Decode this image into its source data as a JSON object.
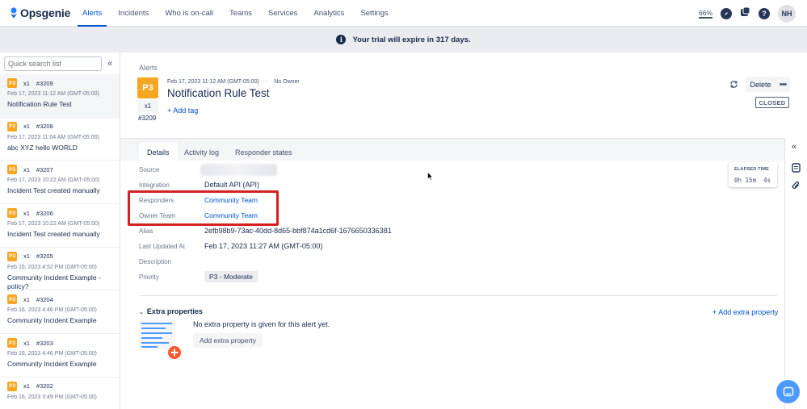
{
  "app": {
    "name": "Opsgenie"
  },
  "nav": {
    "links": [
      "Alerts",
      "Incidents",
      "Who is on-call",
      "Teams",
      "Services",
      "Analytics",
      "Settings"
    ],
    "zoom": "66%",
    "avatar_initials": "NH"
  },
  "banner": {
    "text": "Your trial will expire in 317 days."
  },
  "sidebar": {
    "search_placeholder": "Quick search list",
    "items": [
      {
        "priority": "P3",
        "count": "x1",
        "id": "#3209",
        "date": "Feb 17, 2023 11:12 AM (GMT-05:00)",
        "title": "Notification Rule Test"
      },
      {
        "priority": "P3",
        "count": "x1",
        "id": "#3208",
        "date": "Feb 17, 2023 11:04 AM (GMT-05:00)",
        "title": "abc XYZ hello WORLD"
      },
      {
        "priority": "P3",
        "count": "x1",
        "id": "#3207",
        "date": "Feb 17, 2023 10:22 AM (GMT-05:00)",
        "title": "Incident Test created manually"
      },
      {
        "priority": "P3",
        "count": "x1",
        "id": "#3206",
        "date": "Feb 17, 2023 10:22 AM (GMT-05:00)",
        "title": "Incident Test created manually"
      },
      {
        "priority": "P3",
        "count": "x1",
        "id": "#3205",
        "date": "Feb 16, 2023 4:52 PM (GMT-05:00)",
        "title": "Community Incident Example - policy?"
      },
      {
        "priority": "P3",
        "count": "x1",
        "id": "#3204",
        "date": "Feb 16, 2023 4:46 PM (GMT-05:00)",
        "title": "Community Incident Example"
      },
      {
        "priority": "P3",
        "count": "x1",
        "id": "#3203",
        "date": "Feb 16, 2023 4:46 PM (GMT-05:00)",
        "title": "Community Incident Example"
      },
      {
        "priority": "P3",
        "count": "x1",
        "id": "#3202",
        "date": "Feb 16, 2023 3:49 PM (GMT-05:00)",
        "title": ""
      }
    ]
  },
  "alert": {
    "breadcrumb": "Alerts",
    "priority": "P3",
    "count": "x1",
    "id": "#3209",
    "created": "Feb 17, 2023 11:12 AM (GMT-05:00)",
    "owner": "No Owner",
    "title": "Notification Rule Test",
    "add_tag": "+ Add tag",
    "delete_label": "Delete",
    "status": "CLOSED"
  },
  "tabs": [
    "Details",
    "Activity log",
    "Responder states"
  ],
  "details": {
    "source_label": "Source",
    "integration_label": "Integration",
    "integration_value": "Default API (API)",
    "responders_label": "Responders",
    "responders_value": "Community Team",
    "owner_team_label": "Owner Team",
    "owner_team_value": "Community Team",
    "alias_label": "Alias",
    "alias_value": "2efb98b9-73ac-40dd-8d65-bbf874a1cd6f-1676650336381",
    "updated_label": "Last Updated At",
    "updated_value": "Feb 17, 2023 11:27 AM (GMT-05:00)",
    "description_label": "Description",
    "priority_label": "Priority",
    "priority_value": "P3 - Moderate"
  },
  "elapsed": {
    "label": "ELAPSED TIME",
    "value": "0h 15m  4s"
  },
  "extra": {
    "title": "Extra properties",
    "add_link": "+ Add extra property",
    "empty_text": "No extra property is given for this alert yet.",
    "add_button": "Add extra property"
  },
  "colors": {
    "accent": "#0052cc",
    "priority_p3": "#f6a623",
    "highlight": "#d42020"
  }
}
